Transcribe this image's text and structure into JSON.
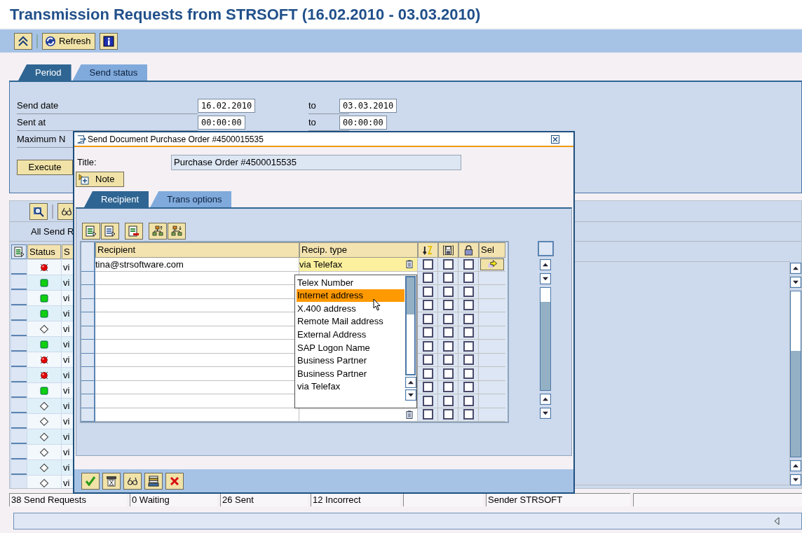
{
  "title": "Transmission Requests from STRSOFT (16.02.2010 - 03.03.2010)",
  "toolbar": {
    "refresh": "Refresh"
  },
  "tabs": [
    {
      "label": "Period",
      "selected": true
    },
    {
      "label": "Send status",
      "selected": false
    }
  ],
  "period": {
    "rows": [
      {
        "label": "Send date",
        "from": "16.02.2010",
        "to_label": "to",
        "to": "03.03.2010"
      },
      {
        "label": "Sent at",
        "from": "00:00:00",
        "to_label": "to",
        "to": "00:00:00"
      },
      {
        "label": "Maximum N"
      }
    ],
    "execute": "Execute"
  },
  "list": {
    "heading": "All Send R",
    "columns": [
      "Status",
      "S"
    ],
    "rows": [
      {
        "kind": "error",
        "column_2": "vi"
      },
      {
        "kind": "ok",
        "column_2": "vi"
      },
      {
        "kind": "ok",
        "column_2": "vi"
      },
      {
        "kind": "ok",
        "column_2": "vi"
      },
      {
        "kind": "pending",
        "column_2": "vi"
      },
      {
        "kind": "ok",
        "column_2": "vi"
      },
      {
        "kind": "error",
        "column_2": "vi"
      },
      {
        "kind": "error",
        "column_2": "vi"
      },
      {
        "kind": "ok",
        "column_2": "vi"
      },
      {
        "kind": "pending",
        "column_2": "vi"
      },
      {
        "kind": "pending",
        "column_2": "vi"
      },
      {
        "kind": "pending",
        "column_2": "vi"
      },
      {
        "kind": "pending",
        "column_2": "vi"
      },
      {
        "kind": "pending",
        "column_2": "vi"
      },
      {
        "kind": "pending",
        "column_2": "vi"
      }
    ]
  },
  "dialog": {
    "title": "Send Document Purchase Order #4500015535",
    "title_label": "Title:",
    "title_value": "Purchase Order #4500015535",
    "note": "Note",
    "tabs": [
      {
        "label": "Recipient",
        "selected": true
      },
      {
        "label": "Trans options",
        "selected": false
      }
    ],
    "columns": [
      "Recipient",
      "Recip. type",
      "Sel"
    ],
    "rows": [
      {
        "recipient": "tina@strsoftware.com",
        "recip_type": "via Telefax",
        "active": true,
        "dropdown_icon": true,
        "checks": [
          false,
          false,
          false
        ],
        "sel_button": true
      },
      {
        "checks": [
          false,
          false,
          false
        ],
        "sel_button": false
      },
      {
        "checks": [
          false,
          false,
          false
        ],
        "sel_button": false
      },
      {
        "checks": [
          false,
          false,
          false
        ],
        "sel_button": false
      },
      {
        "checks": [
          false,
          false,
          false
        ],
        "sel_button": false
      },
      {
        "checks": [
          false,
          false,
          false
        ],
        "sel_button": false
      },
      {
        "checks": [
          false,
          false,
          false
        ],
        "sel_button": false
      },
      {
        "checks": [
          false,
          false,
          false
        ],
        "sel_button": false
      },
      {
        "checks": [
          false,
          false,
          false
        ],
        "sel_button": false
      },
      {
        "checks": [
          false,
          false,
          false
        ],
        "sel_button": false
      },
      {
        "checks": [
          false,
          false,
          false
        ],
        "sel_button": false
      },
      {
        "active": false,
        "dropdown_icon": true,
        "checks": [
          false,
          false,
          false
        ],
        "sel_button": false
      }
    ],
    "dropdown": {
      "options": [
        {
          "label": "Telex Number",
          "selected": false
        },
        {
          "label": "Internet address",
          "selected": true
        },
        {
          "label": "X.400 address",
          "selected": false
        },
        {
          "label": "Remote Mail address",
          "selected": false
        },
        {
          "label": "External Address",
          "selected": false
        },
        {
          "label": "SAP Logon Name",
          "selected": false
        },
        {
          "label": "Business Partner",
          "selected": false
        },
        {
          "label": "Business Partner",
          "selected": false
        },
        {
          "label": "via Telefax",
          "selected": false
        }
      ]
    }
  },
  "status_bar": [
    {
      "kind": "text",
      "text": "38 Send Requests"
    },
    {
      "kind": "text",
      "text": "0 Waiting"
    },
    {
      "kind": "text",
      "text": "26 Sent"
    },
    {
      "kind": "text",
      "text": "12 Incorrect"
    },
    {
      "kind": "blank"
    },
    {
      "kind": "text",
      "text": "Sender STRSOFT"
    },
    {
      "kind": "blank"
    }
  ]
}
